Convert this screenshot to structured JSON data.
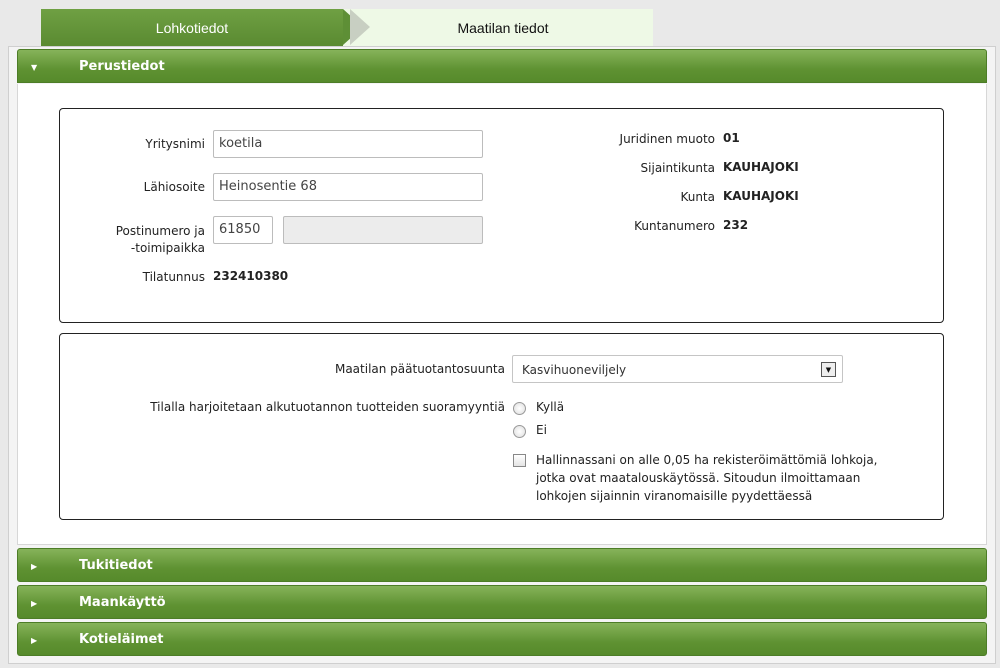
{
  "tabs": {
    "active": "Lohkotiedot",
    "inactive": "Maatilan tiedot"
  },
  "sections": {
    "basic": "Perustiedot",
    "support": "Tukitiedot",
    "landuse": "Maankäyttö",
    "livestock": "Kotieläimet"
  },
  "basic_info": {
    "company_label": "Yritysnimi",
    "company_value": "koetila",
    "address_label": "Lähiosoite",
    "address_value": "Heinosentie 68",
    "postal_label_1": "Postinumero ja",
    "postal_label_2": "-toimipaikka",
    "postal_code": "61850",
    "postal_place": "",
    "farm_id_label": "Tilatunnus",
    "farm_id_value": "232410380",
    "legal_form_label": "Juridinen muoto",
    "legal_form_value": "01",
    "location_municipality_label": "Sijaintikunta",
    "location_municipality_value": "KAUHAJOKI",
    "municipality_label": "Kunta",
    "municipality_value": "KAUHAJOKI",
    "municipality_number_label": "Kuntanumero",
    "municipality_number_value": "232"
  },
  "production": {
    "main_line_label": "Maatilan päätuotantosuunta",
    "main_line_value": "Kasvihuoneviljely",
    "direct_sales_label": "Tilalla harjoitetaan alkutuotannon tuotteiden suoramyyntiä",
    "option_yes": "Kyllä",
    "option_no": "Ei",
    "checkbox_line_1": "Hallinnassani on alle 0,05 ha rekisteröimättömiä lohkoja,",
    "checkbox_line_2": "jotka ovat maatalouskäytössä. Sitoudun ilmoittamaan",
    "checkbox_line_3": "lohkojen sijainnin viranomaisille pyydettäessä"
  }
}
